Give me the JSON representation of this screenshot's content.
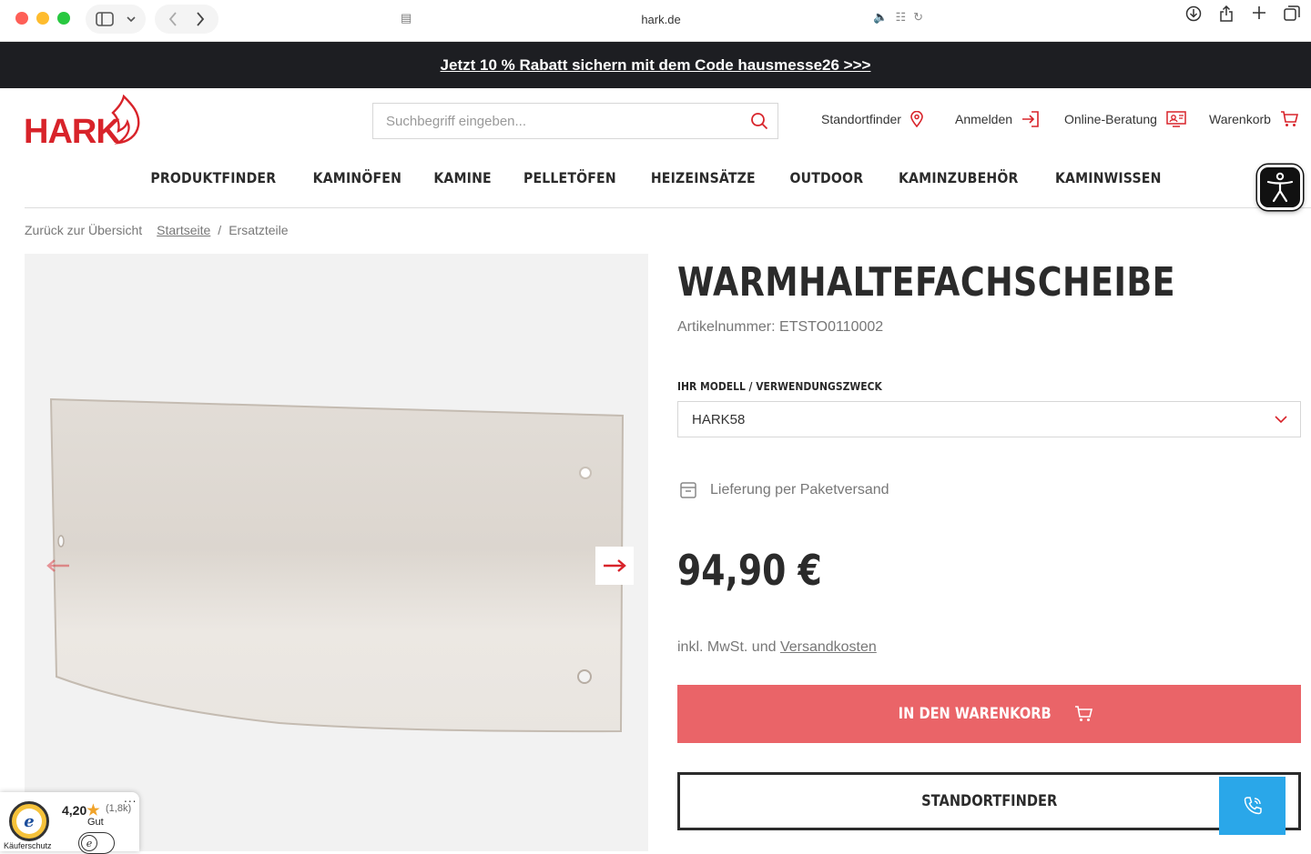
{
  "browser": {
    "url": "hark.de"
  },
  "promo": {
    "text": "Jetzt 10 % Rabatt sichern mit dem Code hausmesse26 >>>"
  },
  "header": {
    "logo_text": "HARK",
    "search_placeholder": "Suchbegriff eingeben...",
    "links": {
      "standortfinder": "Standortfinder",
      "login": "Anmelden",
      "beratung": "Online-Beratung",
      "cart": "Warenkorb"
    }
  },
  "nav": {
    "items": [
      "PRODUKTFINDER",
      "KAMINÖFEN",
      "KAMINE",
      "PELLETÖFEN",
      "HEIZEINSÄTZE",
      "OUTDOOR",
      "KAMINZUBEHÖR",
      "KAMINWISSEN"
    ]
  },
  "breadcrumb": {
    "back": "Zurück zur Übersicht",
    "home": "Startseite",
    "separator": "/",
    "current": "Ersatzteile"
  },
  "gallery": {
    "prev_icon": "arrow-left-icon",
    "next_icon": "arrow-right-icon"
  },
  "product": {
    "title": "WARMHALTEFACHSCHEIBE",
    "sku": "Artikelnummer: ETSTO0110002",
    "model_label": "IHR MODELL / VERWENDUNGSZWECK",
    "model_value": "HARK58",
    "delivery": "Lieferung per Paketversand",
    "price": "94,90 €",
    "tax_prefix": "inkl. MwSt. und",
    "tax_link": "Versandkosten",
    "cart_button": "IN DEN WARENKORB",
    "finder_button": "STANDORTFINDER"
  },
  "trusted_shops": {
    "score": "4,20",
    "count": "(1,8k)",
    "grade": "Gut",
    "protection": "Käuferschutz",
    "dots": "..."
  },
  "colors": {
    "brand_red": "#d8232a",
    "cart_button": "#ea6468",
    "promo_bg": "#1d1e22",
    "callback": "#2aa7e9"
  }
}
